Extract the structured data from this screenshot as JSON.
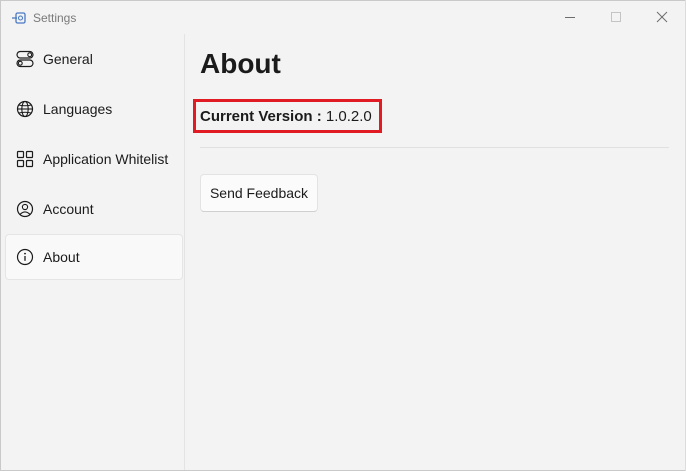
{
  "window": {
    "title": "Settings"
  },
  "sidebar": {
    "items": [
      {
        "label": "General",
        "icon": "toggle-icon",
        "selected": false
      },
      {
        "label": "Languages",
        "icon": "globe-icon",
        "selected": false
      },
      {
        "label": "Application Whitelist",
        "icon": "grid-icon",
        "selected": false
      },
      {
        "label": "Account",
        "icon": "person-icon",
        "selected": false
      },
      {
        "label": "About",
        "icon": "info-icon",
        "selected": true
      }
    ]
  },
  "main": {
    "title": "About",
    "version_label": "Current Version :",
    "version_value": "1.0.2.0",
    "feedback_button": "Send Feedback"
  },
  "colors": {
    "highlight_border": "#e01b24",
    "background": "#f3f3f3",
    "selected_item": "#f9f9f9"
  }
}
